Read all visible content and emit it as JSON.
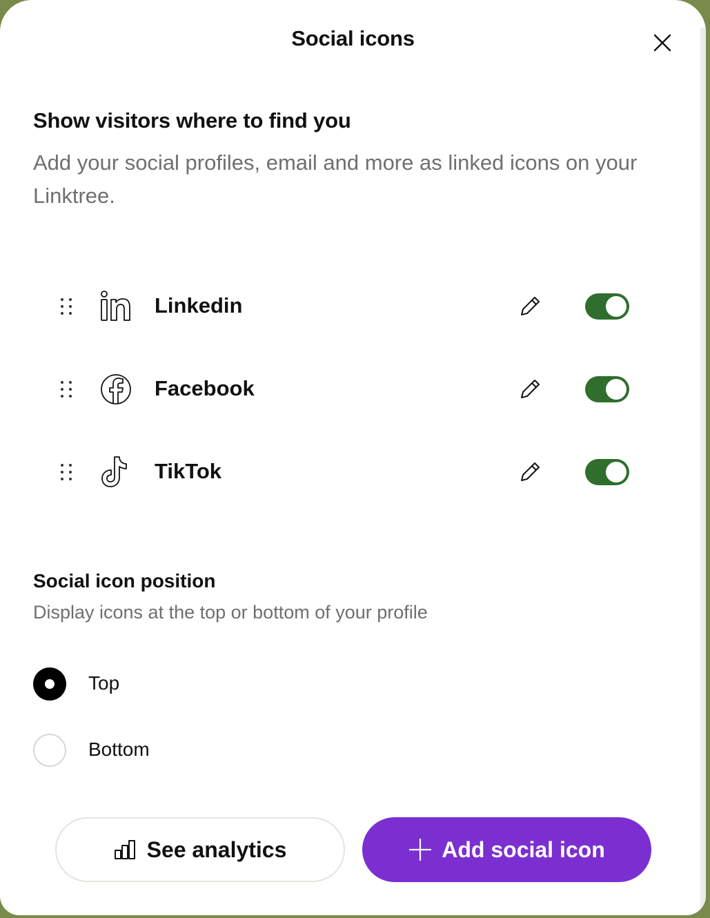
{
  "modal": {
    "title": "Social icons",
    "close_icon": "close-icon"
  },
  "intro": {
    "heading": "Show visitors where to find you",
    "description": "Add your social profiles, email and more as linked icons on your Linktree."
  },
  "social_items": [
    {
      "label": "Linkedin",
      "icon": "linkedin-icon",
      "enabled": true
    },
    {
      "label": "Facebook",
      "icon": "facebook-icon",
      "enabled": true
    },
    {
      "label": "TikTok",
      "icon": "tiktok-icon",
      "enabled": true
    }
  ],
  "position": {
    "heading": "Social icon position",
    "description": "Display icons at the top or bottom of your profile",
    "options": [
      {
        "label": "Top",
        "selected": true
      },
      {
        "label": "Bottom",
        "selected": false
      }
    ]
  },
  "actions": {
    "analytics_label": "See analytics",
    "add_label": "Add social icon"
  },
  "colors": {
    "toggle_on": "#2f6e2c",
    "primary_button": "#7b2fd0"
  }
}
